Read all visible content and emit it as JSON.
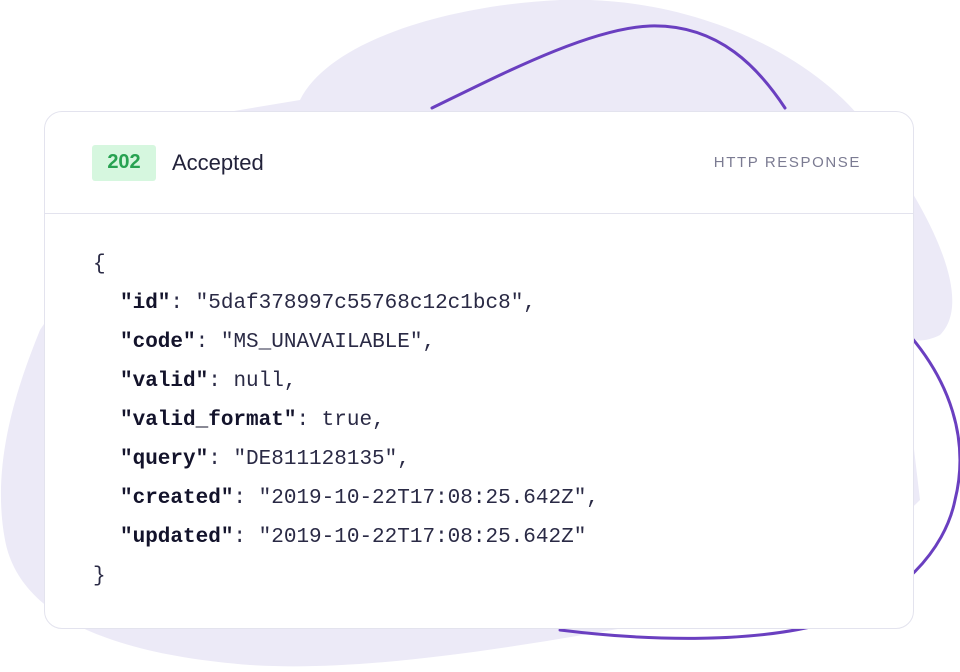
{
  "response": {
    "status_code": "202",
    "status_text": "Accepted",
    "label": "HTTP RESPONSE"
  },
  "json": {
    "open_brace": "{",
    "close_brace": "}",
    "lines": [
      {
        "key": "\"id\"",
        "value": "\"5daf378997c55768c12c1bc8\"",
        "comma": ","
      },
      {
        "key": "\"code\"",
        "value": "\"MS_UNAVAILABLE\"",
        "comma": ","
      },
      {
        "key": "\"valid\"",
        "value": "null",
        "comma": ","
      },
      {
        "key": "\"valid_format\"",
        "value": "true",
        "comma": ","
      },
      {
        "key": "\"query\"",
        "value": "\"DE811128135\"",
        "comma": ","
      },
      {
        "key": "\"created\"",
        "value": "\"2019-10-22T17:08:25.642Z\"",
        "comma": ","
      },
      {
        "key": "\"updated\"",
        "value": "\"2019-10-22T17:08:25.642Z\"",
        "comma": ""
      }
    ]
  },
  "colors": {
    "badge_bg": "#d6f7df",
    "badge_text": "#27a251",
    "blob": "#eceaf7",
    "curve": "#6a3fc0"
  }
}
